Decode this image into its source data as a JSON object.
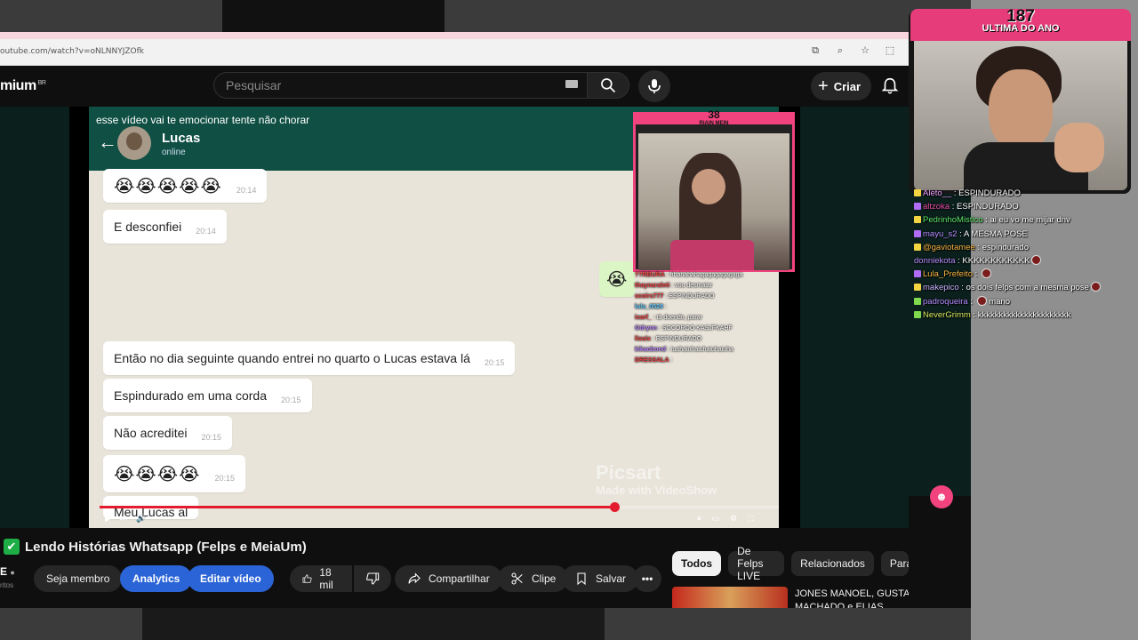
{
  "browser": {
    "url": "outube.com/watch?v=oNLNNYJZOfk",
    "icons": [
      "cast-icon",
      "zoom-icon",
      "star-icon",
      "extensions-icon"
    ]
  },
  "yt_header": {
    "logo": "mium",
    "logo_region": "BR",
    "search_placeholder": "Pesquisar",
    "create_label": "Criar"
  },
  "video": {
    "overlay_text": "esse vídeo vai te emocionar tente não chorar",
    "contact_name": "Lucas",
    "contact_status": "online",
    "messages": [
      {
        "text": "😭😭😭😭😭",
        "time": "20:14"
      },
      {
        "text": "E desconfiei",
        "time": "20:14"
      },
      {
        "text": "Então no dia seguinte quando entrei no quarto o Lucas estava lá",
        "time": "20:15"
      },
      {
        "text": "Espindurado em uma corda",
        "time": "20:15"
      },
      {
        "text": "Não acreditei",
        "time": "20:15"
      },
      {
        "text": "😭😭😭😭",
        "time": "20:15"
      },
      {
        "text": "Meu Lucas al",
        "time": ""
      }
    ],
    "outgoing_emoji": "😭",
    "inner_cam": {
      "number": "38",
      "title": "RIAIN MEIN"
    },
    "inner_chat": [
      {
        "user": "??RBURA",
        "msg": "hhahahahagagagagagaga"
      },
      {
        "user": "thaynaraleti",
        "msg": "vou desmaiar"
      },
      {
        "user": "scoirs777",
        "msg": "ESPINDURADO"
      },
      {
        "user": "lulu_0529",
        "msg": ""
      },
      {
        "user": "icarf_",
        "msg": "tá doendo, parar"
      },
      {
        "user": "Odrynn",
        "msg": "SOCOROO KASJFKAHF"
      },
      {
        "user": "lisuix",
        "msg": "ESPINDURADO"
      },
      {
        "user": "kikaobond",
        "msg": "iuahaiuhaiuhaiuhaiuha"
      },
      {
        "user": "DRESSALA",
        "msg": ""
      }
    ],
    "watermark": "Picsart",
    "watermark_sub": "Made with VideoShow",
    "progress_fraction": 0.76
  },
  "info": {
    "title": "Lendo Histórias Whatsapp (Felps e MeiaUm)",
    "channel_initial": "E",
    "channel_sub": "ritos",
    "buttons": {
      "member": "Seja membro",
      "analytics": "Analytics",
      "edit": "Editar vídeo",
      "likes": "18 mil",
      "share": "Compartilhar",
      "clip": "Clipe",
      "save": "Salvar"
    },
    "chips": [
      "Todos",
      "De Felps LIVE",
      "Relacionados",
      "Para"
    ],
    "rec_title": "JONES MANOEL, GUSTAVO MACHADO e ELIAS JABBOUR"
  },
  "stream_cam": {
    "number": "187",
    "title": "ULTIMA DO ANO"
  },
  "stream_chat": [
    {
      "user": "Aleto__",
      "msg": "ESPINDURADO",
      "color": "#f0a0ff"
    },
    {
      "user": "altzoka",
      "msg": "ESPINDURADO",
      "color": "#e94fa8"
    },
    {
      "user": "PedrinhoMistico",
      "msg": "ai eu vo me mijar dnv",
      "color": "#5fe86b"
    },
    {
      "user": "mayu_s2",
      "msg": "A MESMA POSE",
      "color": "#b48cff"
    },
    {
      "user": "@gaviotamee",
      "msg": "espindurado",
      "color": "#f5b342"
    },
    {
      "user": "donniekota",
      "msg": "KKKKKKKKKKKK",
      "color": "#b48cff"
    },
    {
      "user": "Lula_Prefeito",
      "msg": "",
      "color": "#f5b342"
    },
    {
      "user": "makepico",
      "msg": "os dois felps com a mesma pose",
      "color": "#c9b3ff"
    },
    {
      "user": "padroqueira",
      "msg": "mano",
      "color": "#b48cff"
    },
    {
      "user": "NeverGrimm",
      "msg": "kkkkkkkkkkkkkkkkkkkkkk",
      "color": "#d6e85c"
    }
  ]
}
